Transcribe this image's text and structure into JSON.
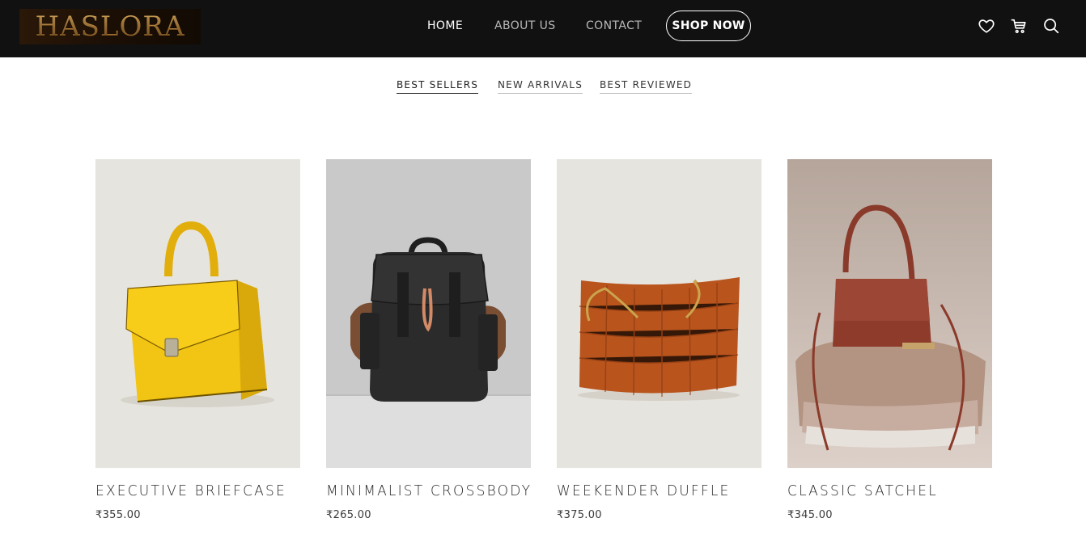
{
  "header": {
    "logo": "HASLORA",
    "nav": [
      {
        "label": "HOME",
        "active": true
      },
      {
        "label": "ABOUT US",
        "active": false
      },
      {
        "label": "CONTACT",
        "active": false
      }
    ],
    "cta": "SHOP NOW",
    "icons": [
      "heart-icon",
      "cart-icon",
      "search-icon"
    ]
  },
  "tabs": [
    {
      "label": "BEST SELLERS",
      "active": true
    },
    {
      "label": "NEW ARRIVALS",
      "active": false
    },
    {
      "label": "BEST REVIEWED",
      "active": false
    }
  ],
  "products": [
    {
      "name": "EXECUTIVE BRIEFCASE",
      "price": "₹355.00",
      "image": "yellow-handbag"
    },
    {
      "name": "MINIMALIST CROSSBODY",
      "price": "₹265.00",
      "image": "black-backpack"
    },
    {
      "name": "WEEKENDER DUFFLE",
      "price": "₹375.00",
      "image": "woven-tote"
    },
    {
      "name": "CLASSIC SATCHEL",
      "price": "₹345.00",
      "image": "brown-mini-bag"
    }
  ],
  "colors": {
    "header_bg": "#111111",
    "logo_gold": "#c9974a",
    "text_dark": "#222222"
  }
}
